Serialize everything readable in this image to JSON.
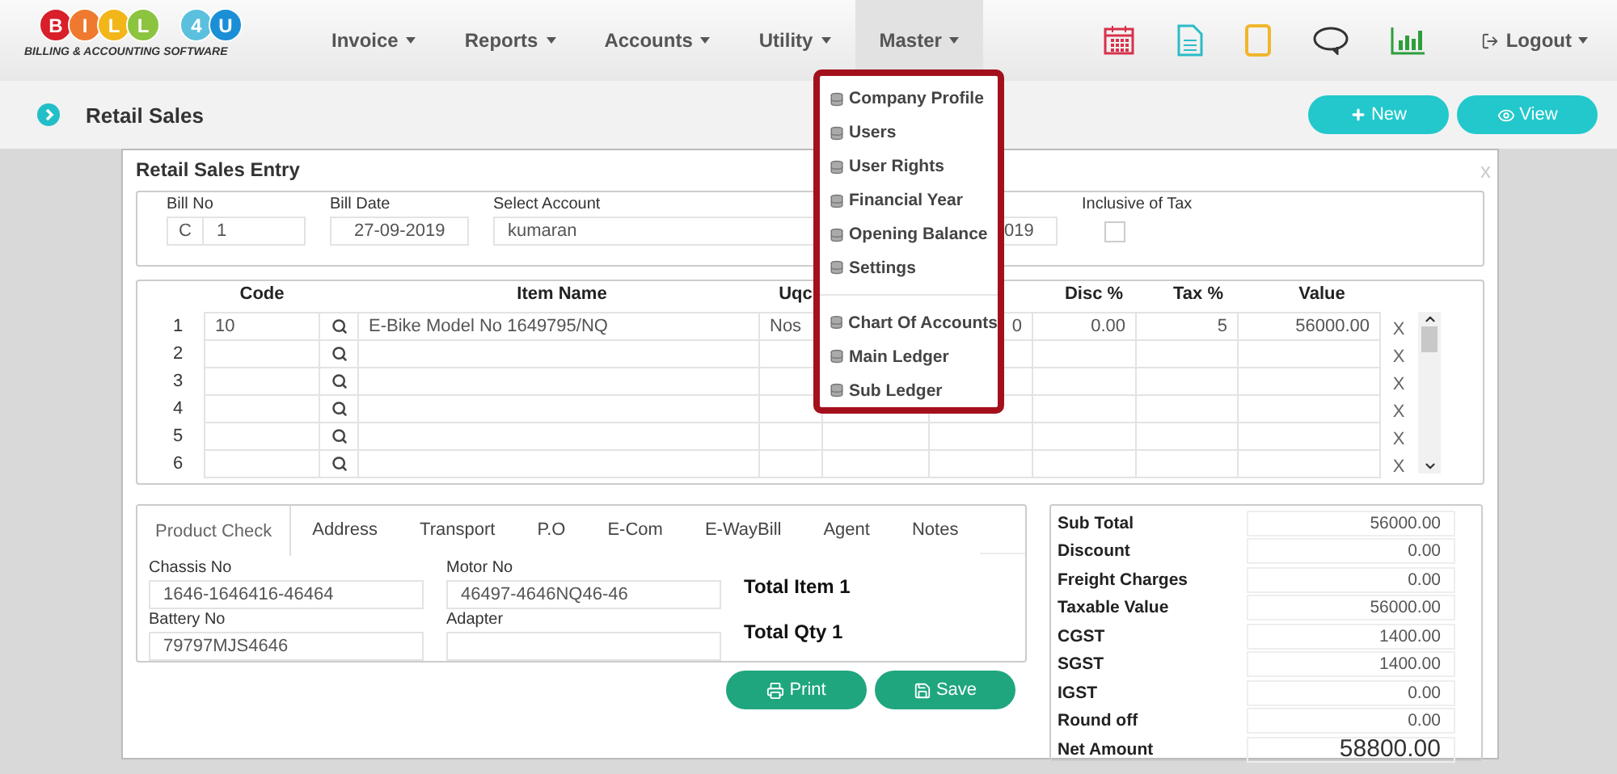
{
  "logo": {
    "letters": [
      {
        "char": "B",
        "color": "#d81f2a"
      },
      {
        "char": "I",
        "color": "#ef7a2f"
      },
      {
        "char": "L",
        "color": "#f2b619"
      },
      {
        "char": "L",
        "color": "#8cc43f"
      },
      {
        "char": "4",
        "color": "#5bc0de"
      },
      {
        "char": "U",
        "color": "#1b8fd6"
      }
    ],
    "tagline": "BILLING & ACCOUNTING SOFTWARE"
  },
  "menu": [
    {
      "label": "Invoice",
      "selected": false
    },
    {
      "label": "Reports",
      "selected": false
    },
    {
      "label": "Accounts",
      "selected": false
    },
    {
      "label": "Utility",
      "selected": false
    },
    {
      "label": "Master",
      "selected": true
    }
  ],
  "logout": "Logout",
  "page": {
    "title": "Retail Sales",
    "actions": [
      {
        "kind": "new",
        "label": "New"
      },
      {
        "kind": "view",
        "label": "View"
      }
    ]
  },
  "dropdown": {
    "groups": [
      [
        "Company Profile",
        "Users",
        "User Rights",
        "Financial Year",
        "Opening Balance",
        "Settings"
      ],
      [
        "Chart Of Accounts",
        "Main Ledger",
        "Sub Ledger"
      ]
    ]
  },
  "form": {
    "title": "Retail Sales Entry",
    "close": "x",
    "header": [
      {
        "kind": "bill",
        "label": "Bill No",
        "prefix": "C",
        "value": "1"
      },
      {
        "kind": "text",
        "label": "Bill Date",
        "value": "27-09-2019"
      },
      {
        "kind": "account",
        "label": "Select Account",
        "value": "kumaran"
      },
      {
        "kind": "partial",
        "value": "019"
      },
      {
        "kind": "checkbox",
        "label": "Inclusive of Tax",
        "checked": false
      }
    ],
    "grid": {
      "columns": [
        "Code",
        "Item Name",
        "Uqc",
        "Disc %",
        "Tax %",
        "Value"
      ],
      "rows": [
        {
          "no": "1",
          "code": "10",
          "item": "E-Bike Model No 1649795/NQ",
          "uqc": "Nos",
          "column_5": "0",
          "disc": "0.00",
          "tax": "5",
          "value": "56000.00",
          "remove": "X"
        },
        {
          "no": "2",
          "remove": "X"
        },
        {
          "no": "3",
          "remove": "X"
        },
        {
          "no": "4",
          "remove": "X"
        },
        {
          "no": "5",
          "remove": "X"
        },
        {
          "no": "6",
          "remove": "X"
        }
      ]
    },
    "tabs": [
      {
        "label": "Product Check",
        "selected": true
      },
      {
        "label": "Address",
        "selected": false
      },
      {
        "label": "Transport",
        "selected": false
      },
      {
        "label": "P.O",
        "selected": false
      },
      {
        "label": "E-Com",
        "selected": false
      },
      {
        "label": "E-WayBill",
        "selected": false
      },
      {
        "label": "Agent",
        "selected": false
      },
      {
        "label": "Notes",
        "selected": false
      }
    ],
    "fields": [
      {
        "label": "Chassis No",
        "value": "1646-1646416-46464"
      },
      {
        "label": "Motor No",
        "value": "46497-4646NQ46-46"
      },
      {
        "label": "Battery No",
        "value": "79797MJS4646"
      },
      {
        "label": "Adapter"
      }
    ],
    "totals": [
      "Total Item 1",
      "Total Qty 1"
    ],
    "buttons": [
      {
        "kind": "print",
        "label": "Print"
      },
      {
        "kind": "save",
        "label": "Save"
      }
    ],
    "summary": [
      {
        "label": "Sub Total",
        "value": "56000.00",
        "kind": "line"
      },
      {
        "label": "Discount",
        "value": "0.00",
        "kind": "line"
      },
      {
        "label": "Freight Charges",
        "value": "0.00",
        "kind": "line"
      },
      {
        "label": "Taxable Value",
        "value": "56000.00",
        "kind": "line"
      },
      {
        "label": "CGST",
        "value": "1400.00",
        "kind": "line"
      },
      {
        "label": "SGST",
        "value": "1400.00",
        "kind": "line"
      },
      {
        "label": "IGST",
        "value": "0.00",
        "kind": "line"
      },
      {
        "label": "Round off",
        "value": "0.00",
        "kind": "line"
      },
      {
        "label": "Net Amount",
        "value": "58800.00",
        "kind": "total"
      }
    ]
  }
}
